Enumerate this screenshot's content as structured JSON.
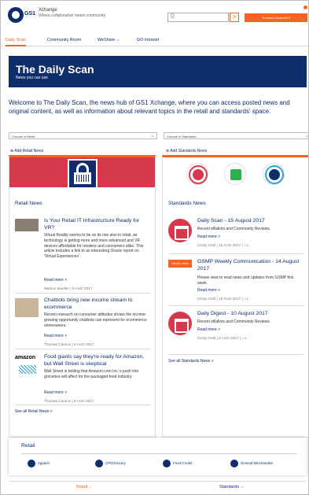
{
  "header": {
    "logo_text": "GS1",
    "brand": "Xchange",
    "tagline": "Where collaboration meets community",
    "search_placeholder": "Q",
    "search_button": ">",
    "user_button": "Thomas Caraccioli ▾"
  },
  "nav": {
    "items": [
      "Daily Scan",
      "Community Room",
      "WeShare ⌵",
      "GO Intranet"
    ],
    "active_color": "#f26522"
  },
  "banner": {
    "title": "The Daily Scan",
    "subtitle": "News you can use"
  },
  "welcome": "Welcome to The Daily Scan, the news hub of GS1 Xchange, where you can access posted news and original content, as well as information about relevant topics in the retail and standards' space.",
  "filters": {
    "retail": "Choose in Retail",
    "standards": "Choose in Standards"
  },
  "add_retail": "⊕ Add Retail News",
  "add_standards": "⊕ Add Standards News",
  "retail": {
    "title": "Retail News",
    "items": [
      {
        "title": "Is Your Retail IT Infrastructure Ready for VR?",
        "body": "Virtual Reality seems to be on its rise also in retail, as technology is getting more and more advanced and VR devices affordable for retailers and consumers alike. This article includes a link to an interesting Oracle report on 'Virtual Experiences'",
        "more": "Read more >",
        "meta": "Markus Mueller | 9 AUG 2017"
      },
      {
        "title": "Chatbots bring new income stream to ecommerce",
        "body": "Recent research on consumer attitudes shows the income-growing opportunity chatbots can represent for ecommerce storeowners.",
        "more": "Read more >",
        "meta": "Thomas Caracci | 9 AUG 2017"
      },
      {
        "title": "Food giants say they're ready for Amazon, but Wall Street is skeptical",
        "body": "Wall Street is betting that Amazon.com Inc.'s push into groceries will affect for the packaged-food industry.",
        "more": "Read more >",
        "meta": "Thomas Caracci | 8 AUG 2017"
      }
    ],
    "amazon_label": "amazon",
    "see_all": "See all Retail News >"
  },
  "standards": {
    "title": "Standards News",
    "items": [
      {
        "title": "Daily Scan - 15 August 2017",
        "body": "Recent eBallots and Community Reviews.",
        "more": "Read more >",
        "meta": "Cindy Grell | 16 AUG 2017 | ♁1"
      },
      {
        "title": "GSMP Weekly Communication - 14 August 2017",
        "body": "Please view to read news and updates from GSMP this week.",
        "more": "Read more >",
        "meta": "Cindy Grell | 15 AUG 2017 | ♁1"
      },
      {
        "title": "Daily Digest - 10 August 2017",
        "body": "Recent eBallots and Community Reviews.",
        "more": "Read more >",
        "meta": "Cindy Grell | 9 AUG 2017 | ♁1"
      }
    ],
    "thumb_label": "What's New",
    "see_all": "See all Standards News >"
  },
  "footer": {
    "title": "Retail",
    "categories": [
      "Apparel",
      "CPG/Grocery",
      "Fresh Foods",
      "General Merchandise"
    ]
  },
  "tabs": {
    "retail": "Retail ⌵",
    "standards": "Standards ⌵"
  },
  "colors": {
    "accent": "#f26522",
    "navy": "#0d2d6b",
    "red": "#d33a4b"
  }
}
